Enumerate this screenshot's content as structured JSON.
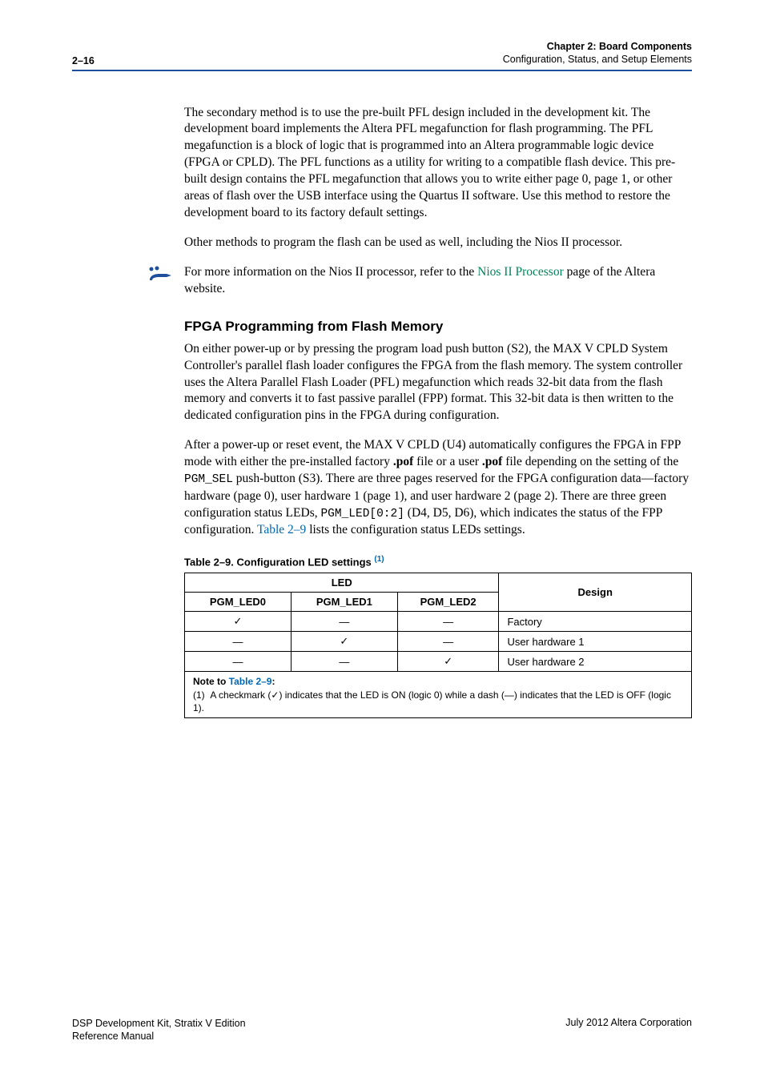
{
  "header": {
    "page_num": "2–16",
    "chapter": "Chapter 2: Board Components",
    "subtitle": "Configuration, Status, and Setup Elements"
  },
  "para1": "The secondary method is to use the pre-built PFL design included in the development kit. The development board implements the Altera PFL megafunction for flash programming. The PFL megafunction is a block of logic that is programmed into an Altera programmable logic device (FPGA or CPLD). The PFL functions as a utility for writing to a compatible flash device. This pre-built design contains the PFL megafunction that allows you to write either page 0, page 1, or other areas of flash over the USB interface using the Quartus II software. Use this method to restore the development board to its factory default settings.",
  "para2": "Other methods to program the flash can be used as well, including the Nios II processor.",
  "info": {
    "pre": "For more information on the Nios II processor, refer to the ",
    "link": "Nios II Processor",
    "post": " page of the Altera website."
  },
  "h3": "FPGA Programming from Flash Memory",
  "para3": "On either power-up or by pressing the program load push button (S2), the MAX V CPLD System Controller's parallel flash loader configures the FPGA from the flash memory. The system controller uses the Altera Parallel Flash Loader (PFL) megafunction which reads 32-bit data from the flash memory and converts it to fast passive parallel (FPP) format. This 32-bit data is then written to the dedicated configuration pins in the FPGA during configuration.",
  "para4_a": "After a power-up or reset event, the MAX V CPLD (U4) automatically configures the FPGA in FPP mode with either the pre-installed factory ",
  "para4_b": " file or a user ",
  "para4_c": " file depending on the setting of the ",
  "para4_code1": "PGM_SEL",
  "para4_d": " push-button (S3). There are three pages reserved for the FPGA configuration data—factory hardware (page 0), user hardware 1 (page 1), and user hardware 2 (page 2). There are three green configuration status LEDs, ",
  "para4_code2": "PGM_LED[0:2]",
  "para4_e": " (D4, D5, D6), which indicates the status of the FPP configuration. ",
  "para4_link": "Table 2–9",
  "para4_f": " lists the configuration status LEDs settings.",
  "pof": ".pof",
  "table": {
    "caption_pre": "Table 2–9. Configuration LED settings ",
    "sup": "(1)",
    "group_head": "LED",
    "col_led0": "PGM_LED0",
    "col_led1": "PGM_LED1",
    "col_led2": "PGM_LED2",
    "col_design": "Design",
    "check": "✓",
    "dash": "—",
    "rows": [
      {
        "c0": "check",
        "c1": "dash",
        "c2": "dash",
        "design": "Factory"
      },
      {
        "c0": "dash",
        "c1": "check",
        "c2": "dash",
        "design": "User hardware 1"
      },
      {
        "c0": "dash",
        "c1": "dash",
        "c2": "check",
        "design": "User hardware 2"
      }
    ],
    "note_head_pre": "Note to ",
    "note_head_link": "Table 2–9",
    "note_head_post": ":",
    "note_body_num": "(1)",
    "note_body_pre": "A checkmark (",
    "note_body_check": "✓",
    "note_body_mid": ") indicates that the LED is ON (logic 0) while a dash (—) indicates that the LED is OFF (logic 1)."
  },
  "footer": {
    "left1": "DSP Development Kit, Stratix V Edition",
    "left2": "Reference Manual",
    "right": "July 2012   Altera Corporation"
  }
}
